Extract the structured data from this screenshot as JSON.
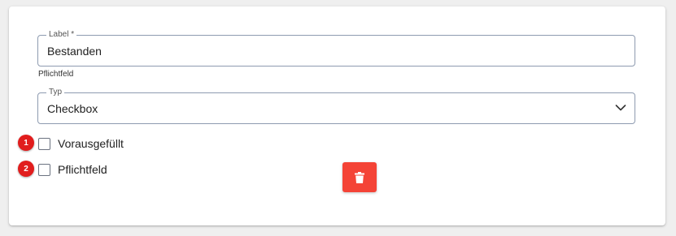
{
  "form": {
    "label_field": {
      "label": "Label *",
      "value": "Bestanden",
      "helper": "Pflichtfeld"
    },
    "type_field": {
      "label": "Typ",
      "value": "Checkbox"
    },
    "checkboxes": [
      {
        "label": "Vorausgefüllt",
        "checked": false,
        "badge": "1"
      },
      {
        "label": "Pflichtfeld",
        "checked": false,
        "badge": "2"
      }
    ]
  },
  "delete_button": {
    "icon": "trash-icon"
  },
  "colors": {
    "badge": "#e11d1d",
    "delete_button": "#f44336",
    "field_border": "#8e9bb0"
  }
}
